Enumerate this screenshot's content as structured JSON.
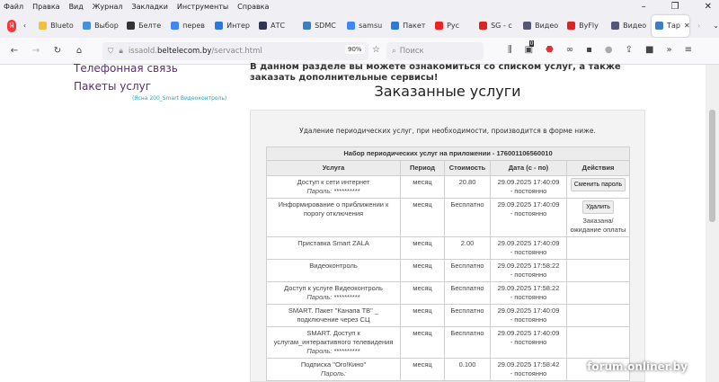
{
  "menu": [
    "Файл",
    "Правка",
    "Вид",
    "Журнал",
    "Закладки",
    "Инструменты",
    "Справка"
  ],
  "tabs": [
    {
      "label": "Blueto",
      "color": "#f0c040"
    },
    {
      "label": "Выбор",
      "color": "#4a90d9"
    },
    {
      "label": "Белте",
      "color": "#333"
    },
    {
      "label": "перев",
      "color": "#4285f4"
    },
    {
      "label": "Интер",
      "color": "#2a7ad9"
    },
    {
      "label": "АТС",
      "color": "#335"
    },
    {
      "label": "SDMC",
      "color": "#3a7fc1"
    },
    {
      "label": "samsu",
      "color": "#4285f4"
    },
    {
      "label": "Пакет",
      "color": "#2a7ad9"
    },
    {
      "label": "Рус",
      "color": "#e22"
    },
    {
      "label": "SG - с",
      "color": "#d22"
    },
    {
      "label": "Видео",
      "color": "#557"
    },
    {
      "label": "ByFly",
      "color": "#d22"
    },
    {
      "label": "Видео",
      "color": "#557"
    },
    {
      "label": "Тар",
      "color": "#3a7fc1",
      "active": true
    }
  ],
  "nav": {
    "url_host": "issaold.",
    "url_domain": "beltelecom.by",
    "url_path": "/servact.html",
    "zoom": "90%",
    "search_placeholder": "Поиск",
    "badge": "0"
  },
  "sidebar": {
    "items": [
      "Телефонная связь",
      "Пакеты услуг"
    ],
    "package": "(Ясна 200_Smart Видеоконтроль)"
  },
  "intro": "В данном разделе вы можете ознакомиться со списком услуг, а также заказать дополнительные сервисы!",
  "title": "Заказанные услуги",
  "note": "Удаление периодических услуг, при необходимости, производится в форме ниже.",
  "table": {
    "caption": "Набор периодических услуг на приложении - 176001106560010",
    "headers": [
      "Услуга",
      "Период",
      "Стоимость",
      "Дата (с - по)",
      "Действия"
    ],
    "rows": [
      {
        "service": "Доступ к сети интернет",
        "pw_label": "Пароль:",
        "pw": "**********",
        "period": "месяц",
        "cost": "20.80",
        "date": "29.09.2025 17:40:09",
        "until": "- постоянно",
        "action": "Сменить пароль"
      },
      {
        "service": "Информирование о приближении к порогу отключения",
        "period": "месяц",
        "cost": "Бесплатно",
        "date": "29.09.2025 17:40:09",
        "until": "- постоянно",
        "action": "Удалить",
        "status": "Заказана/ ожидание оплаты"
      },
      {
        "service": "Приставка Smart ZALA",
        "period": "месяц",
        "cost": "2.00",
        "date": "29.09.2025 17:40:09",
        "until": "- постоянно"
      },
      {
        "service": "Видеоконтроль",
        "period": "месяц",
        "cost": "Бесплатно",
        "date": "29.09.2025 17:58:22",
        "until": "- постоянно"
      },
      {
        "service": "Доступ к услуге Видеоконтроль",
        "pw_label": "Пароль:",
        "pw": "**********",
        "period": "месяц",
        "cost": "Бесплатно",
        "date": "29.09.2025 17:58:22",
        "until": "- постоянно"
      },
      {
        "service": "SMART. Пакет \"Канапа ТВ\" _ подключение через СЦ",
        "period": "месяц",
        "cost": "Бесплатно",
        "date": "29.09.2025 17:40:09",
        "until": "- постоянно"
      },
      {
        "service": "SMART. Доступ к услугам_интерактивного телевидения",
        "pw_label": "Пароль:",
        "pw": "**********",
        "period": "месяц",
        "cost": "Бесплатно",
        "date": "29.09.2025 17:40:09",
        "until": "- постоянно"
      },
      {
        "service": "Подписка \"Ого!Кино\"",
        "pw_label": "Пароль:",
        "pw": "",
        "period": "месяц",
        "cost": "0.100",
        "date": "29.09.2025 17:58:42",
        "until": "- постоянно"
      }
    ]
  },
  "watermark": "forum.onliner.by"
}
